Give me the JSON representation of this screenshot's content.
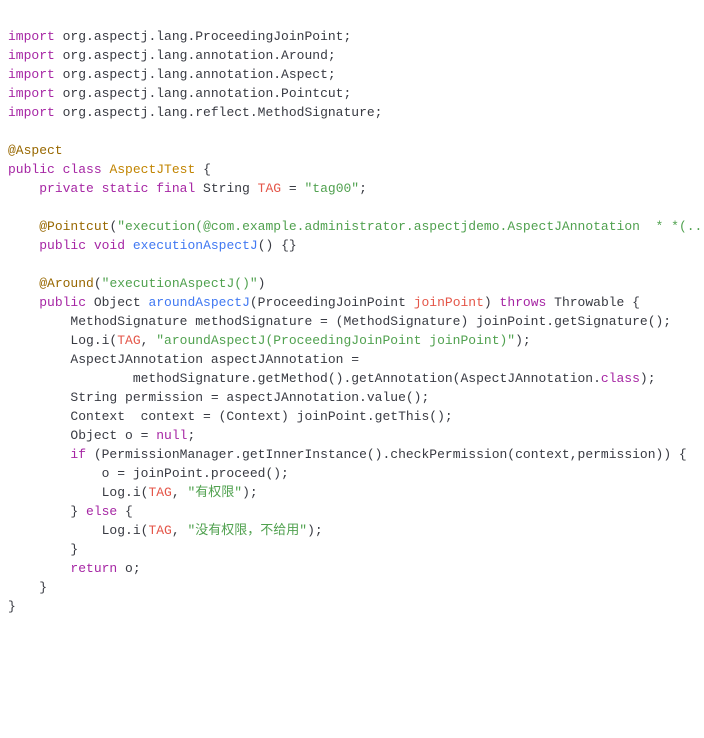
{
  "code": {
    "lines": [
      [
        {
          "t": "import",
          "c": "kw-import"
        },
        {
          "t": " ",
          "c": "plain"
        },
        {
          "t": "org.aspectj.lang.ProceedingJoinPoint;",
          "c": "pkg"
        }
      ],
      [
        {
          "t": "import",
          "c": "kw-import"
        },
        {
          "t": " ",
          "c": "plain"
        },
        {
          "t": "org.aspectj.lang.annotation.Around;",
          "c": "pkg"
        }
      ],
      [
        {
          "t": "import",
          "c": "kw-import"
        },
        {
          "t": " ",
          "c": "plain"
        },
        {
          "t": "org.aspectj.lang.annotation.Aspect;",
          "c": "pkg"
        }
      ],
      [
        {
          "t": "import",
          "c": "kw-import"
        },
        {
          "t": " ",
          "c": "plain"
        },
        {
          "t": "org.aspectj.lang.annotation.Pointcut;",
          "c": "pkg"
        }
      ],
      [
        {
          "t": "import",
          "c": "kw-import"
        },
        {
          "t": " ",
          "c": "plain"
        },
        {
          "t": "org.aspectj.lang.reflect.MethodSignature;",
          "c": "pkg"
        }
      ],
      [],
      [
        {
          "t": "@Aspect",
          "c": "annotation"
        }
      ],
      [
        {
          "t": "public class",
          "c": "kw-modifier"
        },
        {
          "t": " ",
          "c": "plain"
        },
        {
          "t": "AspectJTest",
          "c": "classname"
        },
        {
          "t": " {",
          "c": "plain"
        }
      ],
      [
        {
          "t": "    ",
          "c": "plain"
        },
        {
          "t": "private static final",
          "c": "kw-modifier"
        },
        {
          "t": " String ",
          "c": "plain"
        },
        {
          "t": "TAG",
          "c": "field"
        },
        {
          "t": " = ",
          "c": "plain"
        },
        {
          "t": "\"tag00\"",
          "c": "string"
        },
        {
          "t": ";",
          "c": "plain"
        }
      ],
      [],
      [
        {
          "t": "    ",
          "c": "plain"
        },
        {
          "t": "@Pointcut",
          "c": "annotation"
        },
        {
          "t": "(",
          "c": "plain"
        },
        {
          "t": "\"execution(@com.example.administrator.aspectjdemo.AspectJAnnotation  * *(..))\"",
          "c": "string"
        },
        {
          "t": ")",
          "c": "plain"
        }
      ],
      [
        {
          "t": "    ",
          "c": "plain"
        },
        {
          "t": "public void",
          "c": "kw-modifier"
        },
        {
          "t": " ",
          "c": "plain"
        },
        {
          "t": "executionAspectJ",
          "c": "method"
        },
        {
          "t": "() {}",
          "c": "plain"
        }
      ],
      [],
      [
        {
          "t": "    ",
          "c": "plain"
        },
        {
          "t": "@Around",
          "c": "annotation"
        },
        {
          "t": "(",
          "c": "plain"
        },
        {
          "t": "\"executionAspectJ()\"",
          "c": "string"
        },
        {
          "t": ")",
          "c": "plain"
        }
      ],
      [
        {
          "t": "    ",
          "c": "plain"
        },
        {
          "t": "public",
          "c": "kw-modifier"
        },
        {
          "t": " Object ",
          "c": "plain"
        },
        {
          "t": "aroundAspectJ",
          "c": "method"
        },
        {
          "t": "(ProceedingJoinPoint ",
          "c": "plain"
        },
        {
          "t": "joinPoint",
          "c": "param"
        },
        {
          "t": ") ",
          "c": "plain"
        },
        {
          "t": "throws",
          "c": "kw-modifier"
        },
        {
          "t": " Throwable {",
          "c": "plain"
        }
      ],
      [
        {
          "t": "        MethodSignature methodSignature = (MethodSignature) joinPoint.getSignature();",
          "c": "plain"
        }
      ],
      [
        {
          "t": "        Log.i(",
          "c": "plain"
        },
        {
          "t": "TAG",
          "c": "field"
        },
        {
          "t": ", ",
          "c": "plain"
        },
        {
          "t": "\"aroundAspectJ(ProceedingJoinPoint joinPoint)\"",
          "c": "string"
        },
        {
          "t": ");",
          "c": "plain"
        }
      ],
      [
        {
          "t": "        AspectJAnnotation aspectJAnnotation =",
          "c": "plain"
        }
      ],
      [
        {
          "t": "                methodSignature.getMethod().getAnnotation(AspectJAnnotation.",
          "c": "plain"
        },
        {
          "t": "class",
          "c": "kw-modifier"
        },
        {
          "t": ");",
          "c": "plain"
        }
      ],
      [
        {
          "t": "        String permission = aspectJAnnotation.value();",
          "c": "plain"
        }
      ],
      [
        {
          "t": "        Context  context = (Context) joinPoint.getThis();",
          "c": "plain"
        }
      ],
      [
        {
          "t": "        Object o = ",
          "c": "plain"
        },
        {
          "t": "null",
          "c": "literal"
        },
        {
          "t": ";",
          "c": "plain"
        }
      ],
      [
        {
          "t": "        ",
          "c": "plain"
        },
        {
          "t": "if",
          "c": "kw-control"
        },
        {
          "t": " (PermissionManager.getInnerInstance().checkPermission(context,permission)) {",
          "c": "plain"
        }
      ],
      [
        {
          "t": "            o = joinPoint.proceed();",
          "c": "plain"
        }
      ],
      [
        {
          "t": "            Log.i(",
          "c": "plain"
        },
        {
          "t": "TAG",
          "c": "field"
        },
        {
          "t": ", ",
          "c": "plain"
        },
        {
          "t": "\"有权限\"",
          "c": "string"
        },
        {
          "t": ");",
          "c": "plain"
        }
      ],
      [
        {
          "t": "        } ",
          "c": "plain"
        },
        {
          "t": "else",
          "c": "kw-control"
        },
        {
          "t": " {",
          "c": "plain"
        }
      ],
      [
        {
          "t": "            Log.i(",
          "c": "plain"
        },
        {
          "t": "TAG",
          "c": "field"
        },
        {
          "t": ", ",
          "c": "plain"
        },
        {
          "t": "\"没有权限，不给用\"",
          "c": "string"
        },
        {
          "t": ");",
          "c": "plain"
        }
      ],
      [
        {
          "t": "        }",
          "c": "plain"
        }
      ],
      [
        {
          "t": "        ",
          "c": "plain"
        },
        {
          "t": "return",
          "c": "kw-control"
        },
        {
          "t": " o;",
          "c": "plain"
        }
      ],
      [
        {
          "t": "    }",
          "c": "plain"
        }
      ],
      [
        {
          "t": "}",
          "c": "plain"
        }
      ]
    ]
  }
}
